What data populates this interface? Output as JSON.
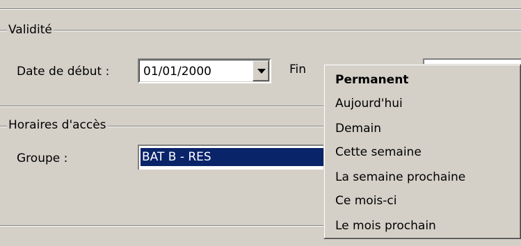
{
  "validite": {
    "group_title": "Validité",
    "start_label": "Date de début :",
    "start_value": "01/01/2000",
    "end_label_partial": "Fin"
  },
  "acces": {
    "group_title": "Horaires d'accès",
    "group_label": "Groupe :",
    "group_value": "BAT B - RES"
  },
  "menu": {
    "items": [
      {
        "label": "Permanent",
        "bold": true
      },
      {
        "label": "Aujourd'hui"
      },
      {
        "label": "Demain"
      },
      {
        "label": "Cette semaine"
      },
      {
        "label": "La semaine prochaine"
      },
      {
        "label": "Ce mois-ci"
      },
      {
        "label": "Le mois prochain"
      }
    ]
  },
  "colors": {
    "dialog_bg": "#d4d0c8",
    "selection_bg": "#0a246a"
  }
}
